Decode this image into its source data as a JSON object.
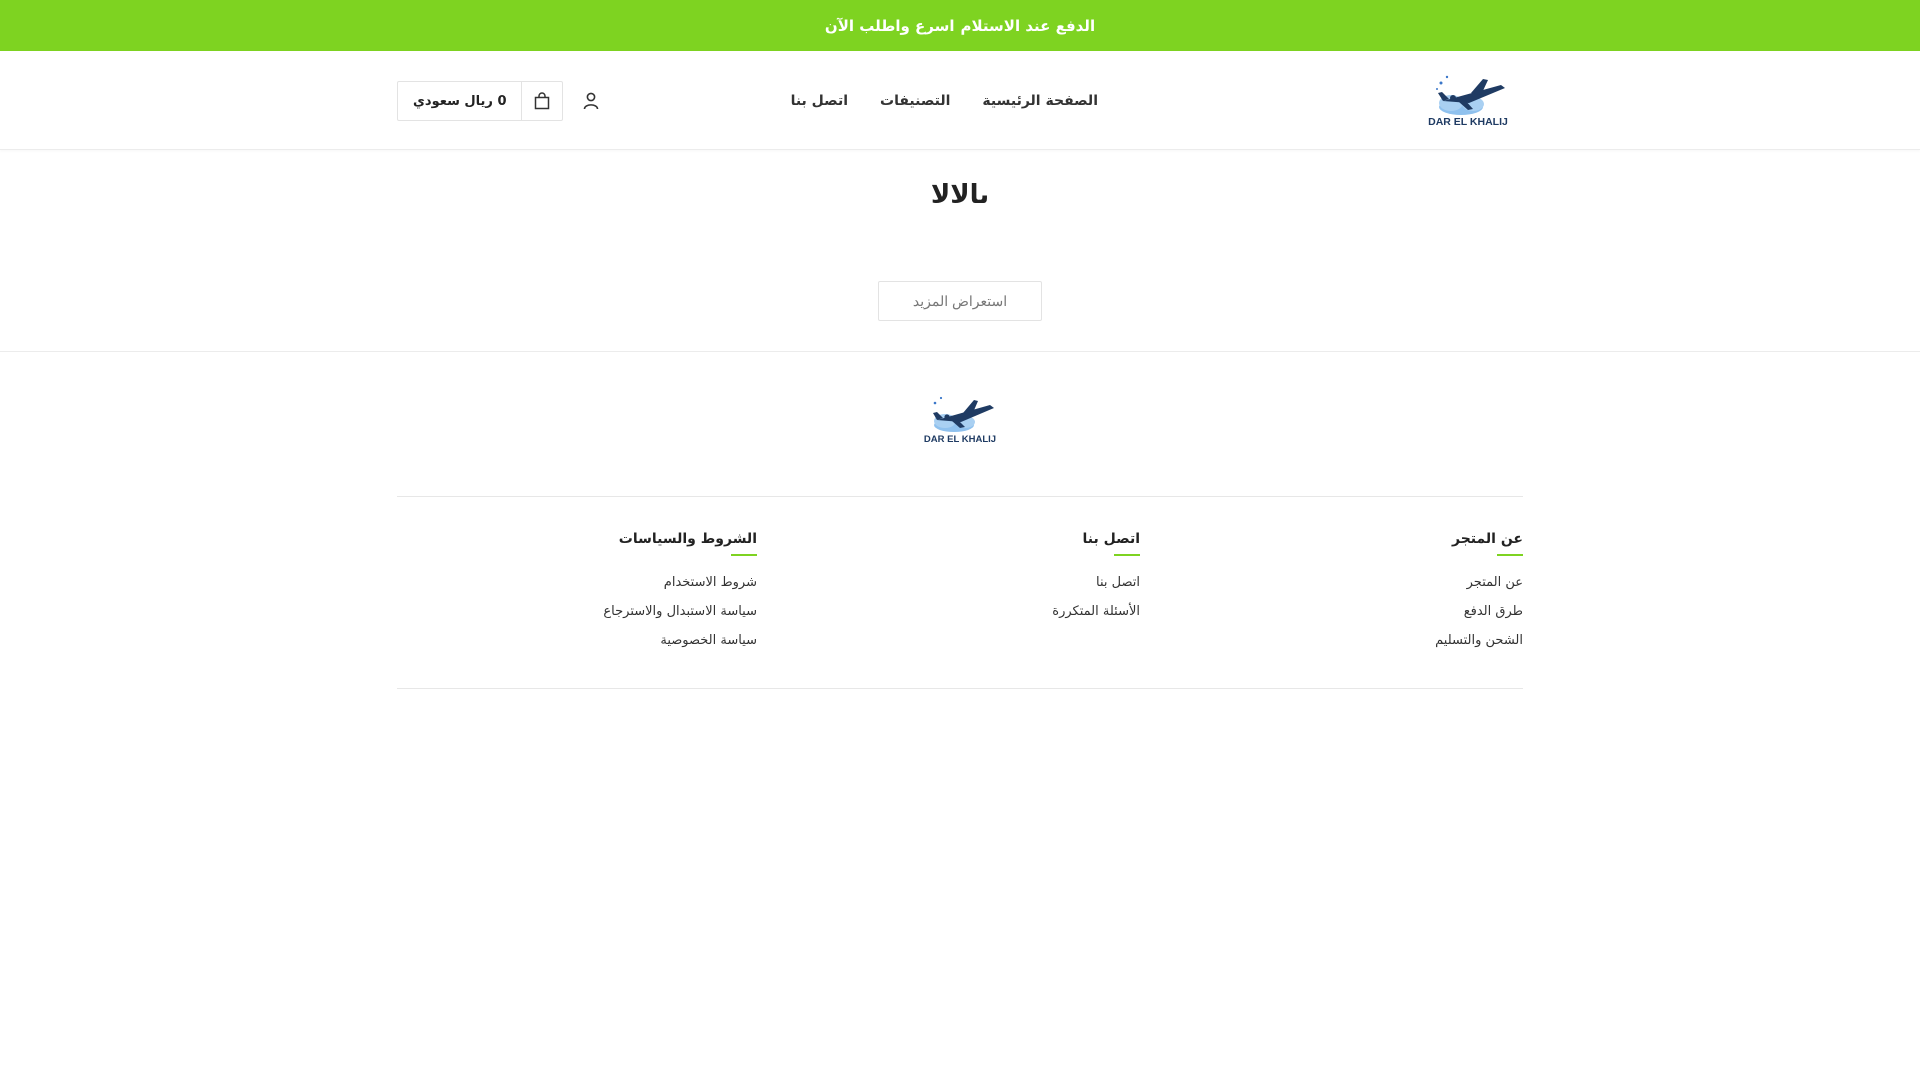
{
  "announcement": {
    "part1": "الدفع عند الاستلام",
    "part2": "اسرع واطلب الآن"
  },
  "brand": {
    "name": "DAR EL KHALIJ",
    "accent": "#7ed321",
    "logo_blue": "#3b77c9",
    "logo_sky": "#8fc1ee"
  },
  "nav": {
    "items": [
      {
        "label": "الصفحة الرئيسية"
      },
      {
        "label": "التصنيفات"
      },
      {
        "label": "اتصل بنا"
      }
    ]
  },
  "header": {
    "user_icon": "user-icon",
    "cart_icon": "cart-icon",
    "cart_total": "0 ريال سعودي"
  },
  "main": {
    "title": "ىالالا",
    "load_more": "استعراض المزيد"
  },
  "footer": {
    "columns": [
      {
        "title": "عن المتجر",
        "links": [
          "عن المتجر",
          "طرق الدفع",
          "الشحن والتسليم"
        ]
      },
      {
        "title": "اتصل بنا",
        "links": [
          "اتصل بنا",
          "الأسئلة المتكررة"
        ]
      },
      {
        "title": "الشروط والسياسات",
        "links": [
          "شروط الاستخدام",
          "سياسة الاستبدال والاسترجاع",
          "سياسة الخصوصية"
        ]
      }
    ]
  }
}
